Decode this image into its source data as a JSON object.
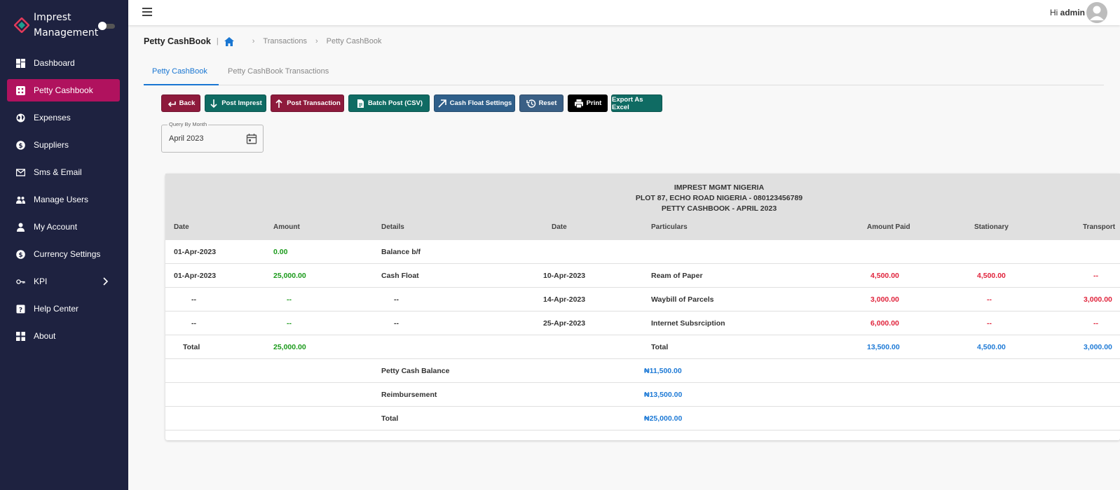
{
  "app": {
    "name_line1": "Imprest",
    "name_line2": "Management"
  },
  "sidebar": {
    "items": [
      {
        "label": "Dashboard",
        "icon": "dashboard-icon"
      },
      {
        "label": "Petty Cashbook",
        "icon": "dice-icon",
        "active": true
      },
      {
        "label": "Expenses",
        "icon": "globe-icon"
      },
      {
        "label": "Suppliers",
        "icon": "dollar-icon"
      },
      {
        "label": "Sms & Email",
        "icon": "mail-icon"
      },
      {
        "label": "Manage Users",
        "icon": "people-icon"
      },
      {
        "label": "My Account",
        "icon": "person-icon"
      },
      {
        "label": "Currency Settings",
        "icon": "currency-icon"
      },
      {
        "label": "KPI",
        "icon": "key-icon",
        "has_submenu": true
      },
      {
        "label": "Help Center",
        "icon": "help-icon"
      },
      {
        "label": "About",
        "icon": "grid-icon"
      }
    ]
  },
  "topbar": {
    "greeting": "Hi",
    "username": "admin"
  },
  "breadcrumb": {
    "page_title": "Petty CashBook",
    "separator": "|",
    "items": [
      "Transactions",
      "Petty CashBook"
    ]
  },
  "tabs": [
    {
      "label": "Petty CashBook",
      "active": true
    },
    {
      "label": "Petty CashBook Transactions",
      "active": false
    }
  ],
  "buttons": [
    {
      "label": "Back",
      "color": "#8e1a3c",
      "icon": "back-arrow-icon"
    },
    {
      "label": "Post Imprest",
      "color": "#0f6b63",
      "icon": "arrow-down-icon"
    },
    {
      "label": "Post Transaction",
      "color": "#8e1a3c",
      "icon": "arrow-up-icon"
    },
    {
      "label": "Batch Post (CSV)",
      "color": "#0f6b63",
      "icon": "file-icon"
    },
    {
      "label": "Cash Float Settings",
      "color": "#2f5f8a",
      "icon": "arrow-diagonal-icon"
    },
    {
      "label": "Reset",
      "color": "#3a5f85",
      "icon": "history-icon"
    },
    {
      "label": "Print",
      "color": "#000000",
      "icon": "printer-icon"
    },
    {
      "label": "Export As Excel",
      "color": "#0f6b63"
    }
  ],
  "query": {
    "label": "Query By Month",
    "value": "April 2023"
  },
  "report": {
    "company": "IMPREST MGMT NIGERIA",
    "address": "PLOT 87, ECHO ROAD NIGERIA - 080123456789",
    "title": "PETTY CASHBOOK - APRIL 2023",
    "columns": [
      "Date",
      "Amount",
      "Details",
      "Date",
      "Particulars",
      "Amount Paid",
      "Stationary",
      "Transport"
    ],
    "rows": [
      [
        "01-Apr-2023",
        "0.00",
        "Balance b/f",
        "",
        "",
        "",
        "",
        ""
      ],
      [
        "01-Apr-2023",
        "25,000.00",
        "Cash Float",
        "10-Apr-2023",
        "Ream of Paper",
        "4,500.00",
        "4,500.00",
        "--"
      ],
      [
        "--",
        "--",
        "--",
        "14-Apr-2023",
        "Waybill of Parcels",
        "3,000.00",
        "--",
        "3,000.00"
      ],
      [
        "--",
        "--",
        "--",
        "25-Apr-2023",
        "Internet Subsrciption",
        "6,000.00",
        "--",
        "--"
      ]
    ],
    "total_row": {
      "label": "Total",
      "amount": "25,000.00",
      "label2": "Total",
      "amount_paid": "13,500.00",
      "stationary": "4,500.00",
      "transport": "3,000.00"
    },
    "summary": [
      {
        "label": "Petty Cash Balance",
        "value": "₦11,500.00"
      },
      {
        "label": "Reimbursement",
        "value": "₦13,500.00"
      },
      {
        "label": "Total",
        "value": "₦25,000.00"
      }
    ]
  },
  "colors": {
    "sidebar": "#1e2240",
    "active": "#b0125e",
    "accent": "#1976d2",
    "green": "#1a9a1a",
    "red": "#e0243c",
    "blue": "#1e7ad6"
  }
}
